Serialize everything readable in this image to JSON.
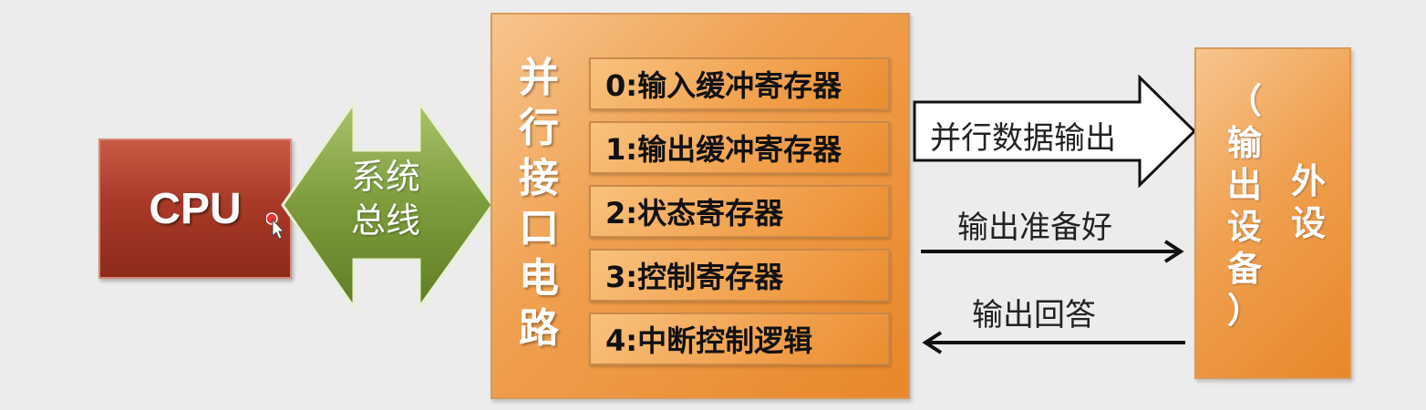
{
  "diagram": {
    "cpu": {
      "label": "CPU"
    },
    "bus": {
      "line1": "系统",
      "line2": "总线"
    },
    "interface": {
      "title_chars": [
        "并",
        "行",
        "接",
        "口",
        "电",
        "路"
      ],
      "registers": [
        "0:输入缓冲寄存器",
        "1:输出缓冲寄存器",
        "2:状态寄存器",
        "3:控制寄存器",
        "4:中断控制逻辑"
      ]
    },
    "arrows": {
      "data_out": "并行数据输出",
      "ready": "输出准备好",
      "ack": "输出回答"
    },
    "peripheral": {
      "col1": [
        "外",
        "设"
      ],
      "col2": [
        "（",
        "输",
        "出",
        "设",
        "备",
        "）"
      ]
    }
  },
  "colors": {
    "cpu": "#a93a28",
    "bus": "#7a9a3a",
    "interface": "#f0a050",
    "arrow_line": "#111111"
  }
}
